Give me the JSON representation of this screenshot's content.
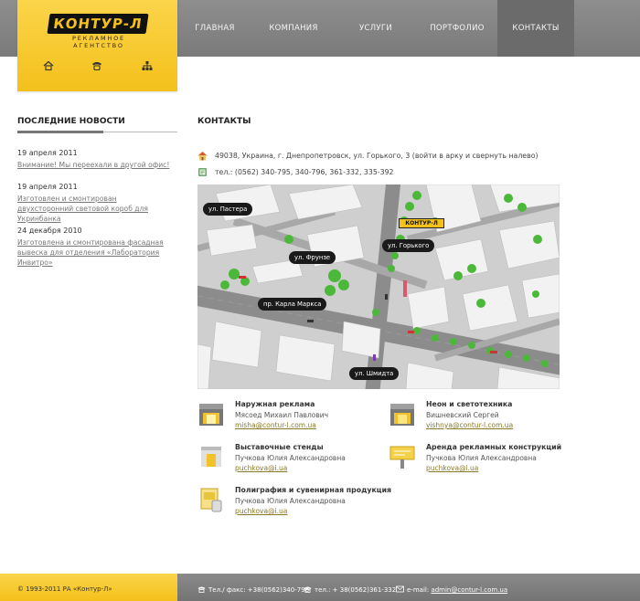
{
  "header": {
    "logo_text": "КОНТУР-Л",
    "logo_sub": "РЕКЛАМНОЕ АГЕНТСТВО",
    "icons": [
      "home-icon",
      "phone-icon",
      "sitemap-icon"
    ],
    "nav": [
      {
        "label": "ГЛАВНАЯ",
        "active": false
      },
      {
        "label": "КОМПАНИЯ",
        "active": false
      },
      {
        "label": "УСЛУГИ",
        "active": false
      },
      {
        "label": "ПОРТФОЛИО",
        "active": false
      },
      {
        "label": "КОНТАКТЫ",
        "active": true
      }
    ]
  },
  "news": {
    "title": "ПОСЛЕДНИЕ НОВОСТИ",
    "items": [
      {
        "date": "19 апреля 2011",
        "text": "Внимание! Мы переехали в другой офис!"
      },
      {
        "date": "19 апреля 2011",
        "text": "Изготовлен и смонтирован двухсторонний световой короб для Укринбанка"
      },
      {
        "date": "24 декабря 2010",
        "text": "Изготовлена и смонтирована фасадная вывеска для отделения «Лаборатория Инвитро»"
      }
    ]
  },
  "contacts": {
    "title": "КОНТАКТЫ",
    "address": "49038, Украина, г. Днепропетровск, ул. Горького, 3 (войти в арку и свернуть налево)",
    "phone": "тел.: (0562) 340-795, 340-796, 361-332, 335-392"
  },
  "map": {
    "labels": {
      "pastera": "ул. Пастера",
      "frunze": "ул. Фрунзе",
      "gorkogo": "ул. Горького",
      "marksa": "пр. Карла Маркса",
      "shmidta": "ул. Шмидта"
    },
    "marker_text": "КОНТУР-Л"
  },
  "services": [
    {
      "title": "Наружная реклама",
      "person": "Мясоед Михаил Павлович",
      "email": "misha@contur-l.com.ua",
      "icon": "storefront-icon"
    },
    {
      "title": "Неон и светотехника",
      "person": "Вишневский Сергей",
      "email": "vishnya@contur-l.com.ua",
      "icon": "neon-storefront-icon"
    },
    {
      "title": "Выставочные стенды",
      "person": "Пучкова Юлия Александровна",
      "email": "puchkova@i.ua",
      "icon": "exhibition-stand-icon"
    },
    {
      "title": "Аренда рекламных конструкций",
      "person": "Пучкова Юлия Александровна",
      "email": "puchkova@i.ua",
      "icon": "billboard-icon"
    },
    {
      "title": "Полиграфия и сувенирная продукция",
      "person": "Пучкова Юлия Александровна",
      "email": "puchkova@i.ua",
      "icon": "printing-icon"
    }
  ],
  "footer": {
    "copyright": "© 1993-2011 РА «Контур-Л»",
    "fax": "Тел./ факс: +38(0562)340-796",
    "phone": "тел.: + 38(0562)361-332",
    "email_label": "e-mail:",
    "email": "admin@contur-l.com.ua"
  },
  "colors": {
    "accent": "#f4c11b",
    "header_gray": "#848484",
    "nav_active": "#6b6b6b"
  }
}
